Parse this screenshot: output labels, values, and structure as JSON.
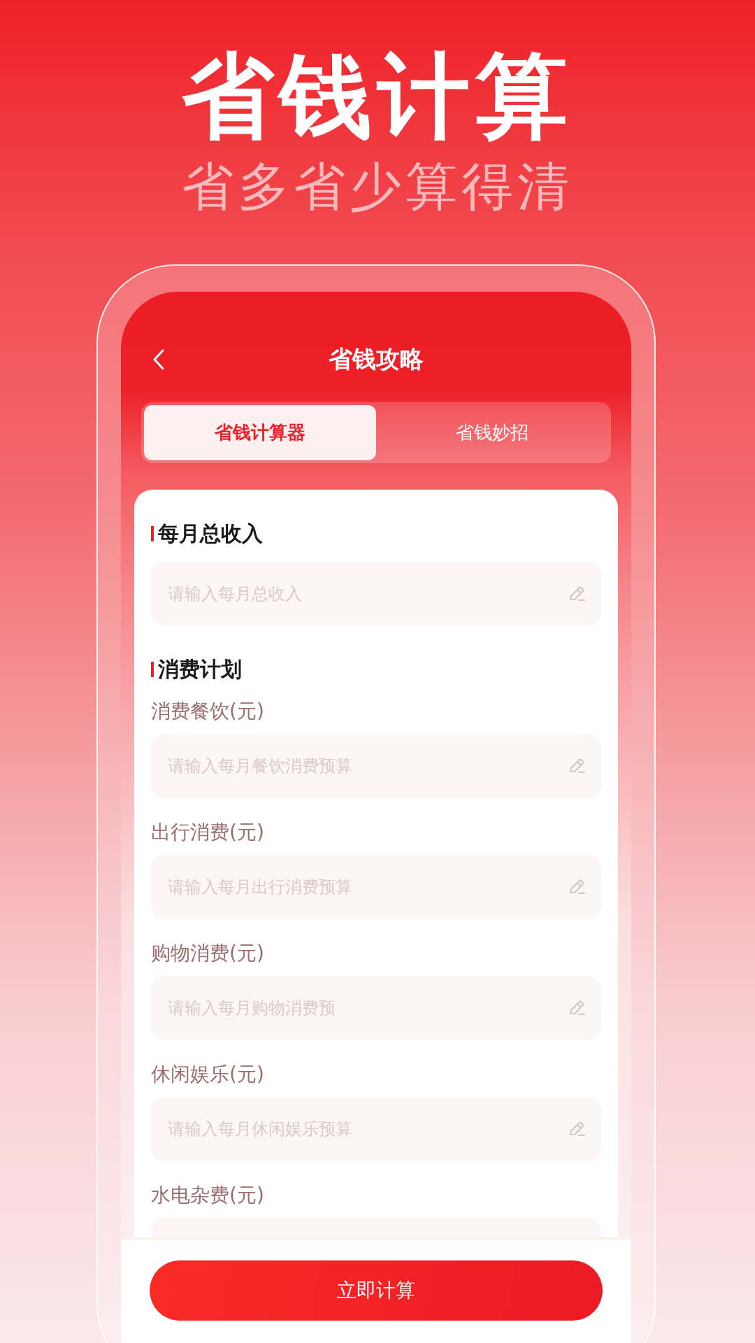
{
  "hero": {
    "title": "省钱计算",
    "subtitle": "省多省少算得清"
  },
  "header": {
    "title": "省钱攻略"
  },
  "tabs": [
    {
      "label": "省钱计算器",
      "selected": true
    },
    {
      "label": "省钱妙招",
      "selected": false
    }
  ],
  "sections": [
    {
      "title": "每月总收入",
      "fields": [
        {
          "placeholder": "请输入每月总收入"
        }
      ]
    },
    {
      "title": "消费计划",
      "fields": [
        {
          "label": "消费餐饮(元)",
          "placeholder": "请输入每月餐饮消费预算"
        },
        {
          "label": "出行消费(元)",
          "placeholder": "请输入每月出行消费预算"
        },
        {
          "label": "购物消费(元)",
          "placeholder": "请输入每月购物消费预"
        },
        {
          "label": "休闲娱乐(元)",
          "placeholder": "请输入每月休闲娱乐预算"
        },
        {
          "label": "水电杂费(元)"
        }
      ]
    }
  ],
  "action_button": "立即计算"
}
